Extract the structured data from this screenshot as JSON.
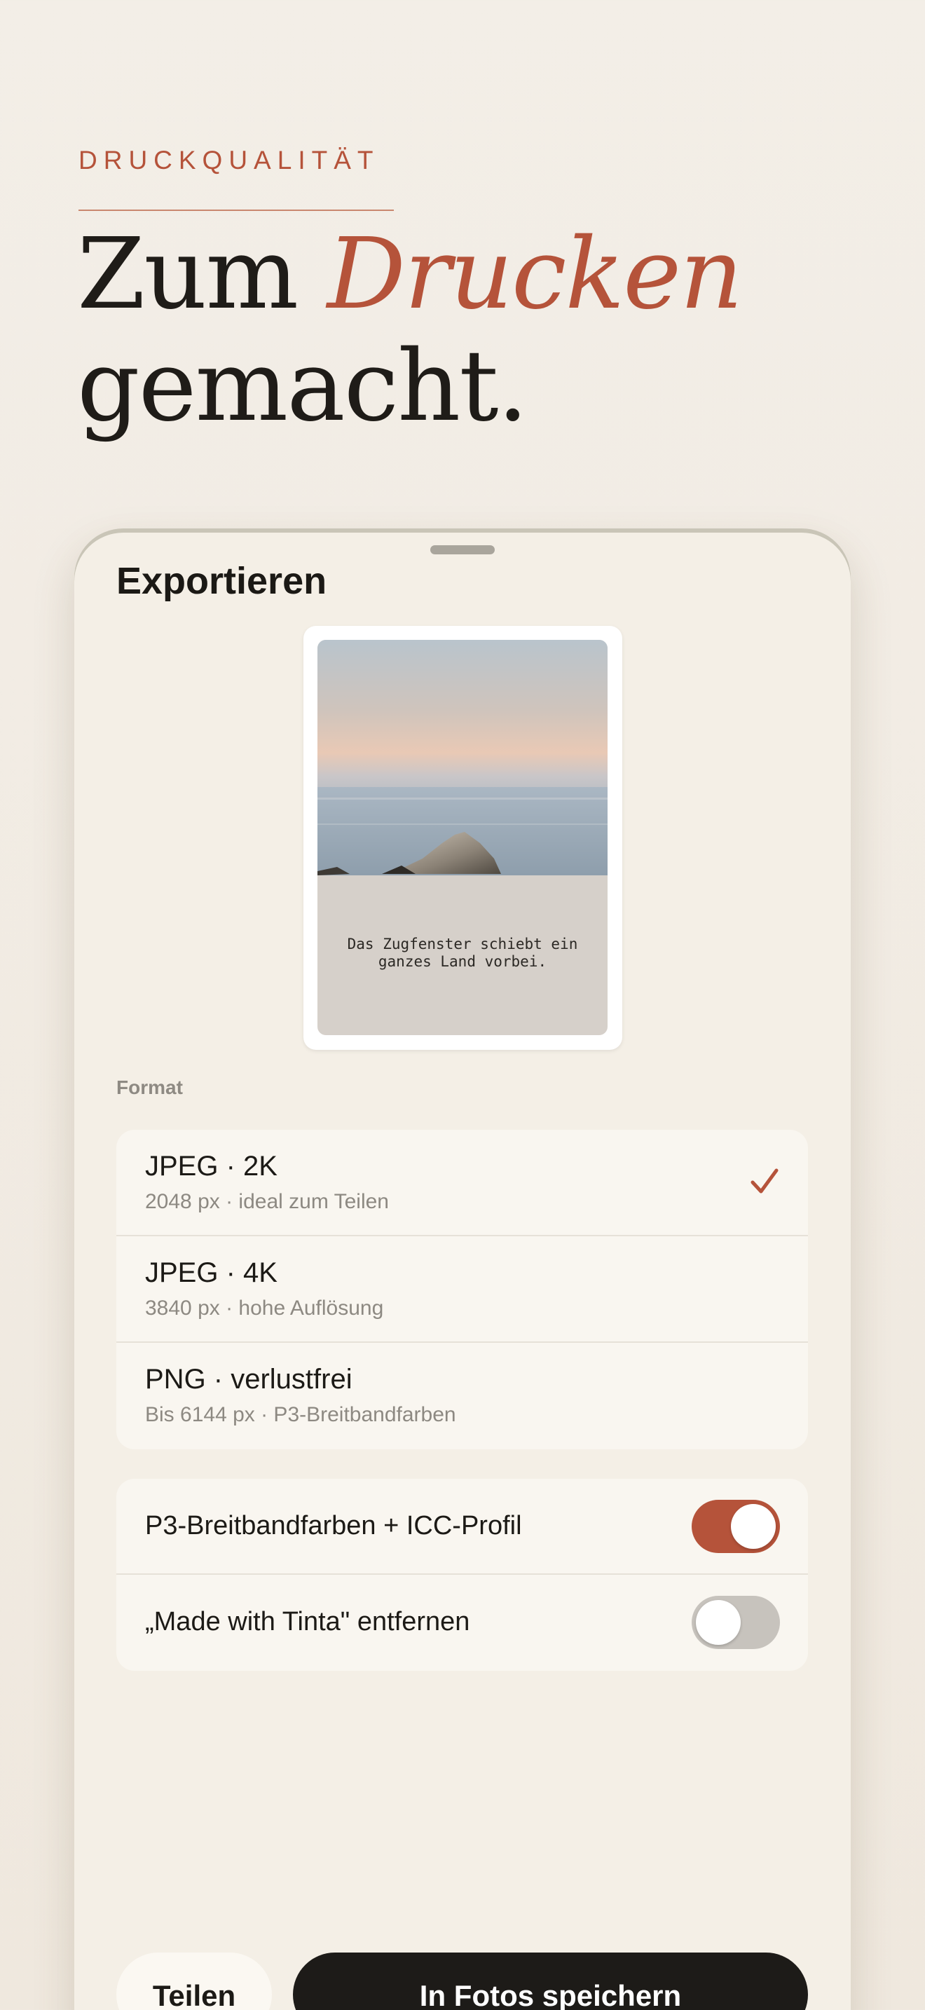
{
  "hero": {
    "eyebrow": "DRUCKQUALITÄT",
    "headline_part1": "Zum ",
    "headline_accent": "Drucken",
    "headline_part2": "gemacht."
  },
  "sheet": {
    "title": "Exportieren",
    "preview": {
      "caption": "Das Zugfenster schiebt ein\nganzes Land vorbei."
    },
    "format_label": "Format",
    "formats": [
      {
        "title": "JPEG · 2K",
        "subtitle": "2048 px · ideal zum Teilen",
        "selected": true
      },
      {
        "title": "JPEG · 4K",
        "subtitle": "3840 px · hohe Auflösung",
        "selected": false
      },
      {
        "title": "PNG · verlustfrei",
        "subtitle": "Bis 6144 px · P3-Breitbandfarben",
        "selected": false
      }
    ],
    "toggles": [
      {
        "label": "P3-Breitbandfarben + ICC-Profil",
        "on": true
      },
      {
        "label": "„Made with Tinta\" entfernen",
        "on": false
      }
    ],
    "buttons": {
      "share": "Teilen",
      "save": "In Fotos speichern"
    }
  },
  "colors": {
    "accent": "#b5533a",
    "background": "#f1ebe3",
    "sheet": "#f4efe6",
    "dark_button": "#1d1b18"
  },
  "icons": {
    "selected_check": "checkmark-icon"
  }
}
